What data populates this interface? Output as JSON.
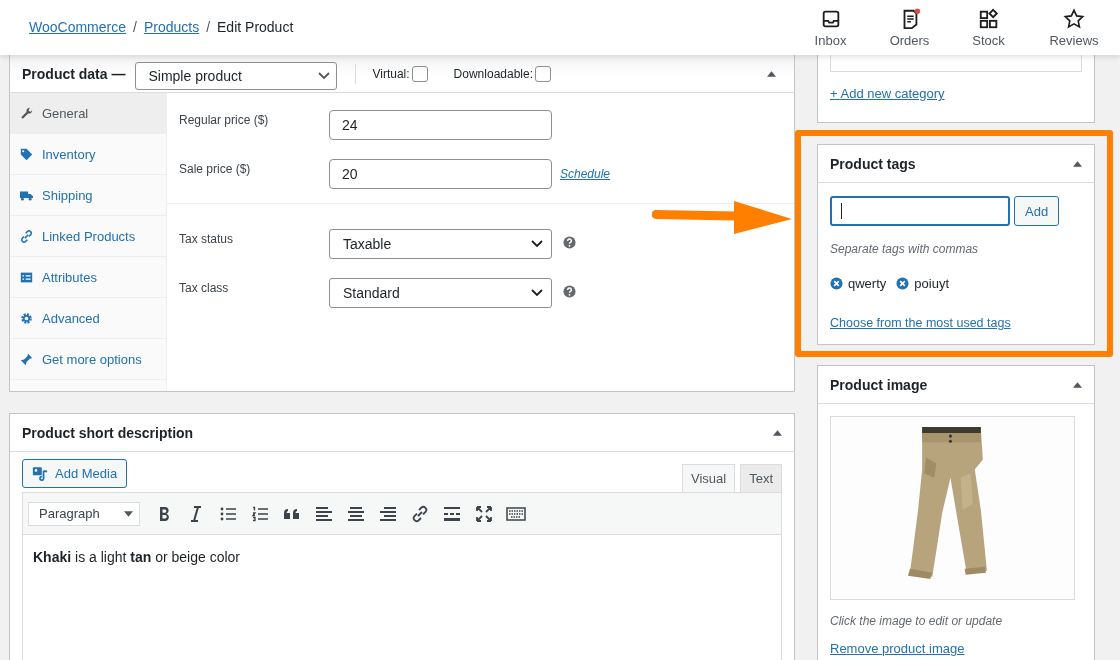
{
  "breadcrumb": [
    {
      "label": "WooCommerce",
      "link": true
    },
    {
      "label": "Products",
      "link": true,
      "separator": "/"
    },
    {
      "label": "Edit Product",
      "link": false,
      "separator": "/"
    }
  ],
  "header_actions": [
    {
      "label": "Inbox",
      "notification": false
    },
    {
      "label": "Orders",
      "notification": true
    },
    {
      "label": "Stock",
      "notification": false
    },
    {
      "label": "Reviews",
      "notification": false
    }
  ],
  "product_data": {
    "title": "Product data —",
    "type": "Simple product",
    "options": [
      {
        "label": "Virtual:",
        "checked": false
      },
      {
        "label": "Downloadable:",
        "checked": false
      }
    ],
    "tabs": [
      {
        "label": "General",
        "selected": true
      },
      {
        "label": "Inventory",
        "selected": false
      },
      {
        "label": "Shipping",
        "selected": false
      },
      {
        "label": "Linked Products",
        "selected": false
      },
      {
        "label": "Attributes",
        "selected": false
      },
      {
        "label": "Advanced",
        "selected": false
      },
      {
        "label": "Get more options",
        "selected": false
      }
    ],
    "field_groups": [
      [
        {
          "label": "Regular price ($)",
          "kind": "input",
          "value": "24"
        },
        {
          "label": "Sale price ($)",
          "kind": "input",
          "value": "20",
          "link": "Schedule"
        }
      ],
      [
        {
          "label": "Tax status",
          "kind": "select",
          "value": "Taxable",
          "help": true
        },
        {
          "label": "Tax class",
          "kind": "select",
          "value": "Standard",
          "help": true
        }
      ]
    ]
  },
  "short_description": {
    "title": "Product short description",
    "add_media": "Add Media",
    "editor_tabs": [
      {
        "label": "Visual",
        "selected": true
      },
      {
        "label": "Text",
        "selected": false
      }
    ],
    "format": "Paragraph",
    "content": "**Khaki** is a light **tan** or beige color"
  },
  "categories": {
    "add_link": "+ Add new category"
  },
  "product_tags": {
    "title": "Product tags",
    "highlighted": true,
    "input": {
      "focused": true
    },
    "add_button": "Add",
    "hint": "Separate tags with commas",
    "tags": [
      "qwerty",
      "poiuyt"
    ],
    "most_used_link": "Choose from the most used tags"
  },
  "product_image": {
    "title": "Product image",
    "hint": "Click the image to edit or update",
    "remove_link": "Remove product image"
  }
}
